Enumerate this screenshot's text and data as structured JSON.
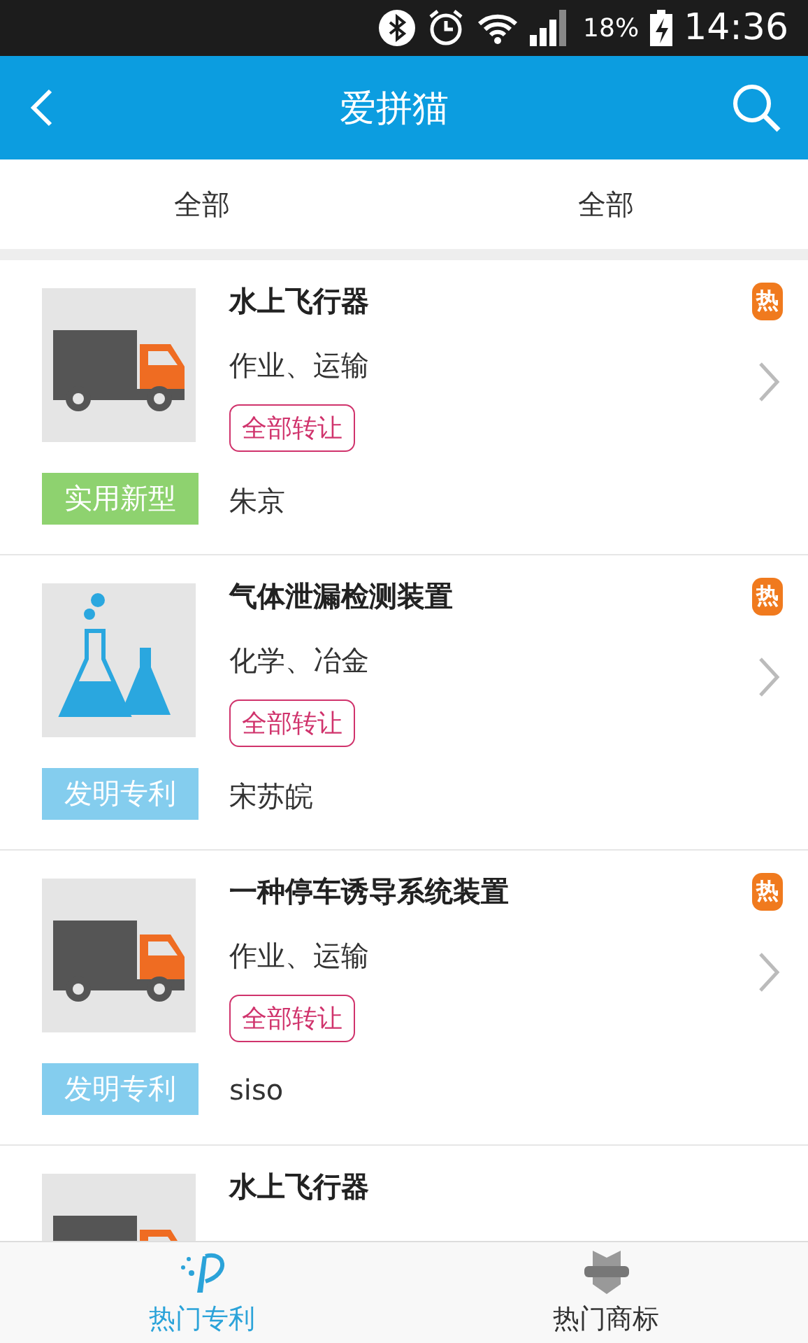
{
  "status_bar": {
    "battery": "18%",
    "time": "14:36"
  },
  "header": {
    "title": "爱拼猫"
  },
  "filters": [
    "全部",
    "全部"
  ],
  "items": [
    {
      "kind": "truck",
      "title": "水上飞行器",
      "category": "作业、运输",
      "tag": "全部转让",
      "type": "实用新型",
      "color": "#8ed26f",
      "owner": "朱京",
      "badge": "热"
    },
    {
      "kind": "flask",
      "title": "气体泄漏检测装置",
      "category": "化学、冶金",
      "tag": "全部转让",
      "type": "发明专利",
      "color": "#84cdee",
      "owner": "宋苏皖",
      "badge": "热"
    },
    {
      "kind": "truck",
      "title": "一种停车诱导系统装置",
      "category": "作业、运输",
      "tag": "全部转让",
      "type": "发明专利",
      "color": "#84cdee",
      "owner": "siso",
      "badge": "热"
    },
    {
      "kind": "truck",
      "title": "水上飞行器"
    }
  ],
  "bottom_nav": [
    {
      "label": "热门专利",
      "kind": "patent",
      "selected": true
    },
    {
      "label": "热门商标",
      "kind": "trademark",
      "selected": false
    }
  ]
}
